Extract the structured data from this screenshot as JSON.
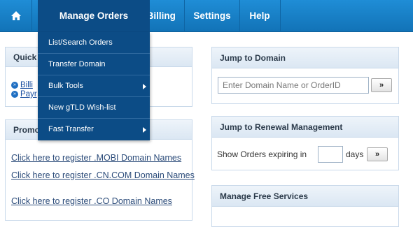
{
  "nav": {
    "home_icon": "home-icon",
    "items": [
      {
        "label": "Manage Orders"
      },
      {
        "label": "My Billing"
      },
      {
        "label": "Settings"
      },
      {
        "label": "Help"
      }
    ]
  },
  "dropdown": {
    "items": [
      {
        "label": "List/Search Orders",
        "submenu": false
      },
      {
        "label": "Transfer Domain",
        "submenu": false
      },
      {
        "label": "Bulk Tools",
        "submenu": true
      },
      {
        "label": "New gTLD Wish-list",
        "submenu": false
      },
      {
        "label": "Fast Transfer",
        "submenu": true
      }
    ]
  },
  "quick": {
    "title": "Quick",
    "links": [
      "Billi",
      "Payr"
    ]
  },
  "promo": {
    "title": "Promo",
    "links": [
      "Click here to register .MOBI Domain Names",
      "Click here to register .CN.COM Domain Names",
      "Click here to register .CO Domain Names"
    ]
  },
  "jump_domain": {
    "title": "Jump to Domain",
    "placeholder": "Enter Domain Name or OrderID",
    "button": "»"
  },
  "jump_renewal": {
    "title": "Jump to Renewal Management",
    "prefix": "Show Orders expiring in",
    "days_value": "",
    "suffix": "days",
    "button": "»"
  },
  "free_services": {
    "title": "Manage Free Services"
  },
  "colors": {
    "nav_bg": "#1a82c9",
    "nav_active": "#0c4c86",
    "link": "#2c4c7a"
  }
}
